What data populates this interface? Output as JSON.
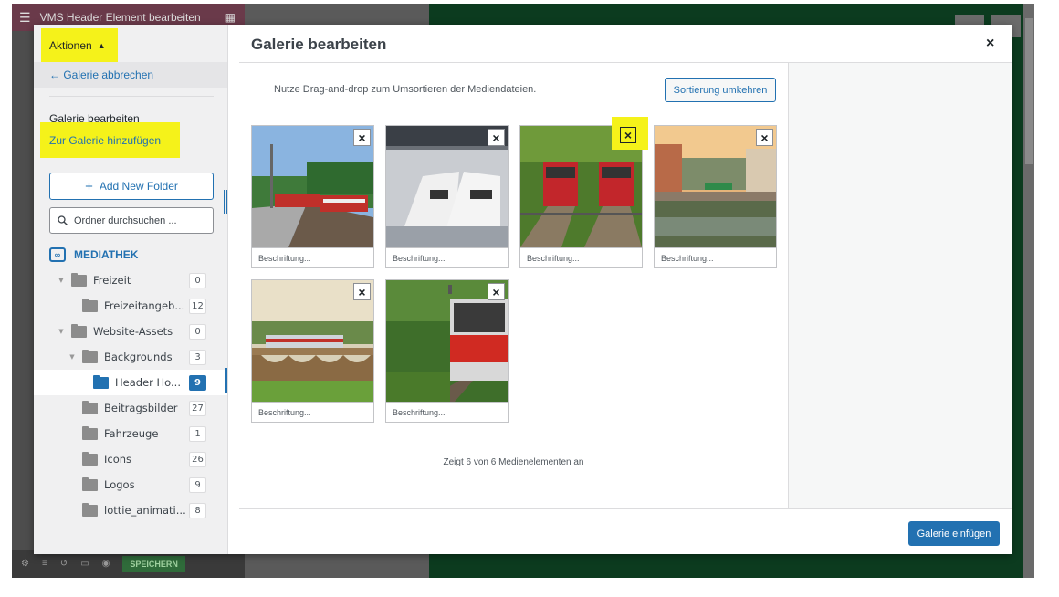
{
  "background": {
    "app_title": "VMS Header Element bearbeiten",
    "save_label": "SPEICHERN",
    "colors": {
      "topbar": "#6a3a4a",
      "canvas": "#0c3b1f"
    }
  },
  "menu": {
    "actions_label": "Aktionen",
    "cancel_label": "← Galerie abbrechen",
    "edit_gallery_label": "Galerie bearbeiten",
    "add_to_gallery_label": "Zur Galerie hinzufügen",
    "add_folder_label": "Add New Folder",
    "search_placeholder": "Ordner durchsuchen ...",
    "root_label": "MEDIATHEK",
    "folders": [
      {
        "name": "Freizeit",
        "count": "0",
        "expanded": true
      },
      {
        "name": "Freizeitangeb...",
        "count": "12"
      },
      {
        "name": "Website-Assets",
        "count": "0",
        "expanded": true
      },
      {
        "name": "Backgrounds",
        "count": "3",
        "expanded": true
      },
      {
        "name": "Header Ho...",
        "count": "9",
        "active": true
      },
      {
        "name": "Beitragsbilder",
        "count": "27"
      },
      {
        "name": "Fahrzeuge",
        "count": "1"
      },
      {
        "name": "Icons",
        "count": "26"
      },
      {
        "name": "Logos",
        "count": "9"
      },
      {
        "name": "lottie_animati...",
        "count": "8"
      }
    ]
  },
  "frame": {
    "title": "Galerie bearbeiten",
    "close_label": "×",
    "instructions": "Nutze Drag-and-drop zum Umsortieren der Mediendateien.",
    "reverse_label": "Sortierung umkehren",
    "caption_placeholder": "Beschriftung...",
    "remove_label": "×",
    "items": [
      {
        "scene": "regional-train-station"
      },
      {
        "scene": "modern-trains-hall"
      },
      {
        "scene": "red-railcars-forest"
      },
      {
        "scene": "town-bridge-river"
      },
      {
        "scene": "train-on-viaduct"
      },
      {
        "scene": "red-tram-green"
      }
    ],
    "count_text": "Zeigt 6 von 6 Medienelementen an",
    "insert_label": "Galerie einfügen",
    "accent_color": "#2271b1",
    "highlight_color": "#f5f21a"
  }
}
